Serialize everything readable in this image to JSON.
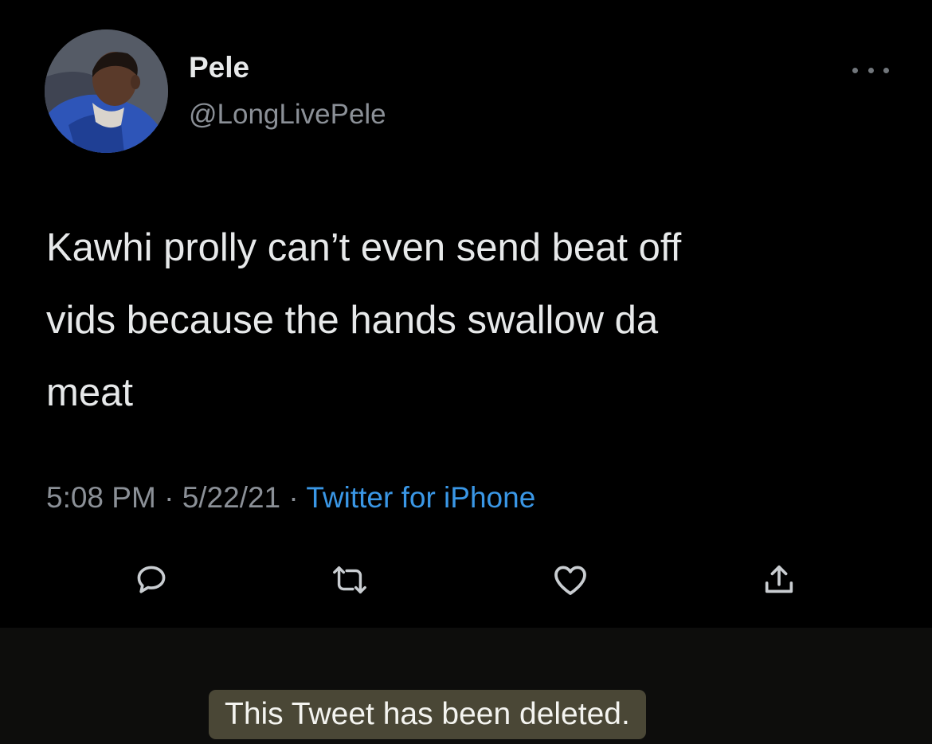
{
  "tweet": {
    "author": {
      "display_name": "Pele",
      "handle": "@LongLivePele"
    },
    "text": "Kawhi prolly can’t even send beat off\nvids because the hands swallow da\nmeat",
    "time": "5:08 PM",
    "separator": " · ",
    "date": "5/22/21",
    "source": "Twitter for iPhone",
    "actions": [
      {
        "icon": "reply-icon"
      },
      {
        "icon": "retweet-icon"
      },
      {
        "icon": "like-icon"
      },
      {
        "icon": "share-icon"
      }
    ],
    "more_icon": "more-options-icon"
  },
  "overlay": {
    "caption": "This Tweet has been deleted."
  },
  "colors": {
    "background": "#000000",
    "text_primary": "#e7e9ea",
    "text_secondary": "#8b9097",
    "link": "#3a97e6",
    "caption_bg": "#4a4736",
    "caption_text": "#f4f4f0"
  }
}
